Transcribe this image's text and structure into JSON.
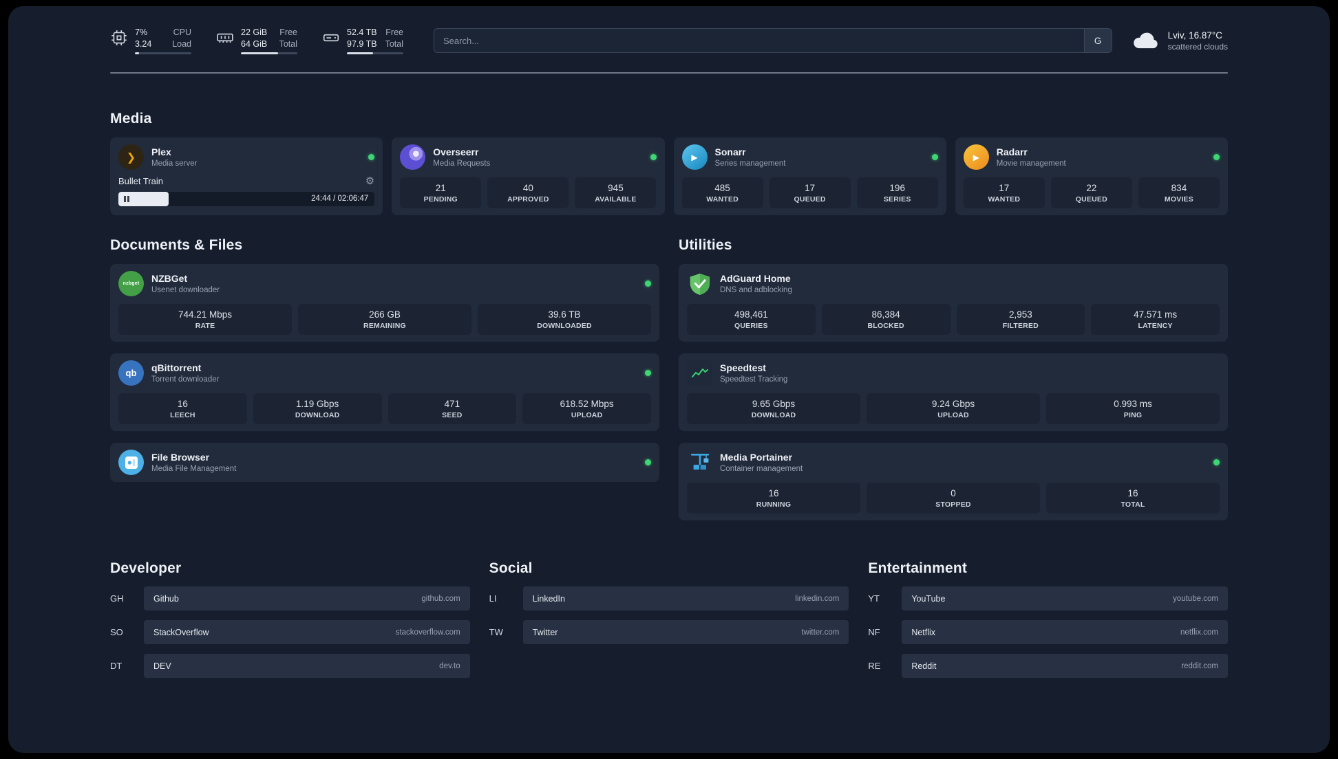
{
  "colors": {
    "status_green": "#3ed674",
    "page_bg": "#161e2d",
    "card_bg": "#222b3b",
    "accent_blue": "#3ca7e2"
  },
  "topbar": {
    "resources": [
      {
        "icon": "cpu-icon",
        "rows": [
          {
            "value": "7%",
            "label": "CPU"
          },
          {
            "value": "3.24",
            "label": "Load"
          }
        ],
        "progress": 7
      },
      {
        "icon": "memory-icon",
        "rows": [
          {
            "value": "22 GiB",
            "label": "Free"
          },
          {
            "value": "64 GiB",
            "label": "Total"
          }
        ],
        "progress": 66
      },
      {
        "icon": "disk-icon",
        "rows": [
          {
            "value": "52.4 TB",
            "label": "Free"
          },
          {
            "value": "97.9 TB",
            "label": "Total"
          }
        ],
        "progress": 46
      }
    ],
    "search": {
      "placeholder": "Search...",
      "provider": "G"
    },
    "weather": {
      "location": "Lviv, 16.87°C",
      "condition": "scattered clouds"
    }
  },
  "sections": {
    "media": "Media",
    "documents": "Documents & Files",
    "utilities": "Utilities"
  },
  "glyphs": {
    "plex": "❯",
    "play": "▶",
    "gear": "⚙"
  },
  "services": {
    "plex": {
      "title": "Plex",
      "subtitle": "Media server",
      "now_playing": "Bullet Train",
      "time": "24:44 / 02:06:47",
      "progress": 19.5
    },
    "overseerr": {
      "title": "Overseerr",
      "subtitle": "Media Requests",
      "stats": [
        {
          "value": "21",
          "label": "PENDING"
        },
        {
          "value": "40",
          "label": "APPROVED"
        },
        {
          "value": "945",
          "label": "AVAILABLE"
        }
      ]
    },
    "sonarr": {
      "title": "Sonarr",
      "subtitle": "Series management",
      "stats": [
        {
          "value": "485",
          "label": "WANTED"
        },
        {
          "value": "17",
          "label": "QUEUED"
        },
        {
          "value": "196",
          "label": "SERIES"
        }
      ]
    },
    "radarr": {
      "title": "Radarr",
      "subtitle": "Movie management",
      "stats": [
        {
          "value": "17",
          "label": "WANTED"
        },
        {
          "value": "22",
          "label": "QUEUED"
        },
        {
          "value": "834",
          "label": "MOVIES"
        }
      ]
    },
    "nzbget": {
      "title": "NZBGet",
      "subtitle": "Usenet downloader",
      "icon_text": "nzbget",
      "stats": [
        {
          "value": "744.21 Mbps",
          "label": "RATE"
        },
        {
          "value": "266 GB",
          "label": "REMAINING"
        },
        {
          "value": "39.6 TB",
          "label": "DOWNLOADED"
        }
      ]
    },
    "qbittorrent": {
      "title": "qBittorrent",
      "subtitle": "Torrent downloader",
      "icon_text": "qb",
      "stats": [
        {
          "value": "16",
          "label": "LEECH"
        },
        {
          "value": "1.19 Gbps",
          "label": "DOWNLOAD"
        },
        {
          "value": "471",
          "label": "SEED"
        },
        {
          "value": "618.52 Mbps",
          "label": "UPLOAD"
        }
      ]
    },
    "filebrowser": {
      "title": "File Browser",
      "subtitle": "Media File Management"
    },
    "adguard": {
      "title": "AdGuard Home",
      "subtitle": "DNS and adblocking",
      "stats": [
        {
          "value": "498,461",
          "label": "QUERIES"
        },
        {
          "value": "86,384",
          "label": "BLOCKED"
        },
        {
          "value": "2,953",
          "label": "FILTERED"
        },
        {
          "value": "47.571 ms",
          "label": "LATENCY"
        }
      ]
    },
    "speedtest": {
      "title": "Speedtest",
      "subtitle": "Speedtest Tracking",
      "stats": [
        {
          "value": "9.65 Gbps",
          "label": "DOWNLOAD"
        },
        {
          "value": "9.24 Gbps",
          "label": "UPLOAD"
        },
        {
          "value": "0.993 ms",
          "label": "PING"
        }
      ]
    },
    "portainer": {
      "title": "Media Portainer",
      "subtitle": "Container management",
      "stats": [
        {
          "value": "16",
          "label": "RUNNING"
        },
        {
          "value": "0",
          "label": "STOPPED"
        },
        {
          "value": "16",
          "label": "TOTAL"
        }
      ]
    }
  },
  "bookmarks": [
    {
      "heading": "Developer",
      "items": [
        {
          "abbr": "GH",
          "name": "Github",
          "url": "github.com"
        },
        {
          "abbr": "SO",
          "name": "StackOverflow",
          "url": "stackoverflow.com"
        },
        {
          "abbr": "DT",
          "name": "DEV",
          "url": "dev.to"
        }
      ]
    },
    {
      "heading": "Social",
      "items": [
        {
          "abbr": "LI",
          "name": "LinkedIn",
          "url": "linkedin.com"
        },
        {
          "abbr": "TW",
          "name": "Twitter",
          "url": "twitter.com"
        }
      ]
    },
    {
      "heading": "Entertainment",
      "items": [
        {
          "abbr": "YT",
          "name": "YouTube",
          "url": "youtube.com"
        },
        {
          "abbr": "NF",
          "name": "Netflix",
          "url": "netflix.com"
        },
        {
          "abbr": "RE",
          "name": "Reddit",
          "url": "reddit.com"
        }
      ]
    }
  ]
}
